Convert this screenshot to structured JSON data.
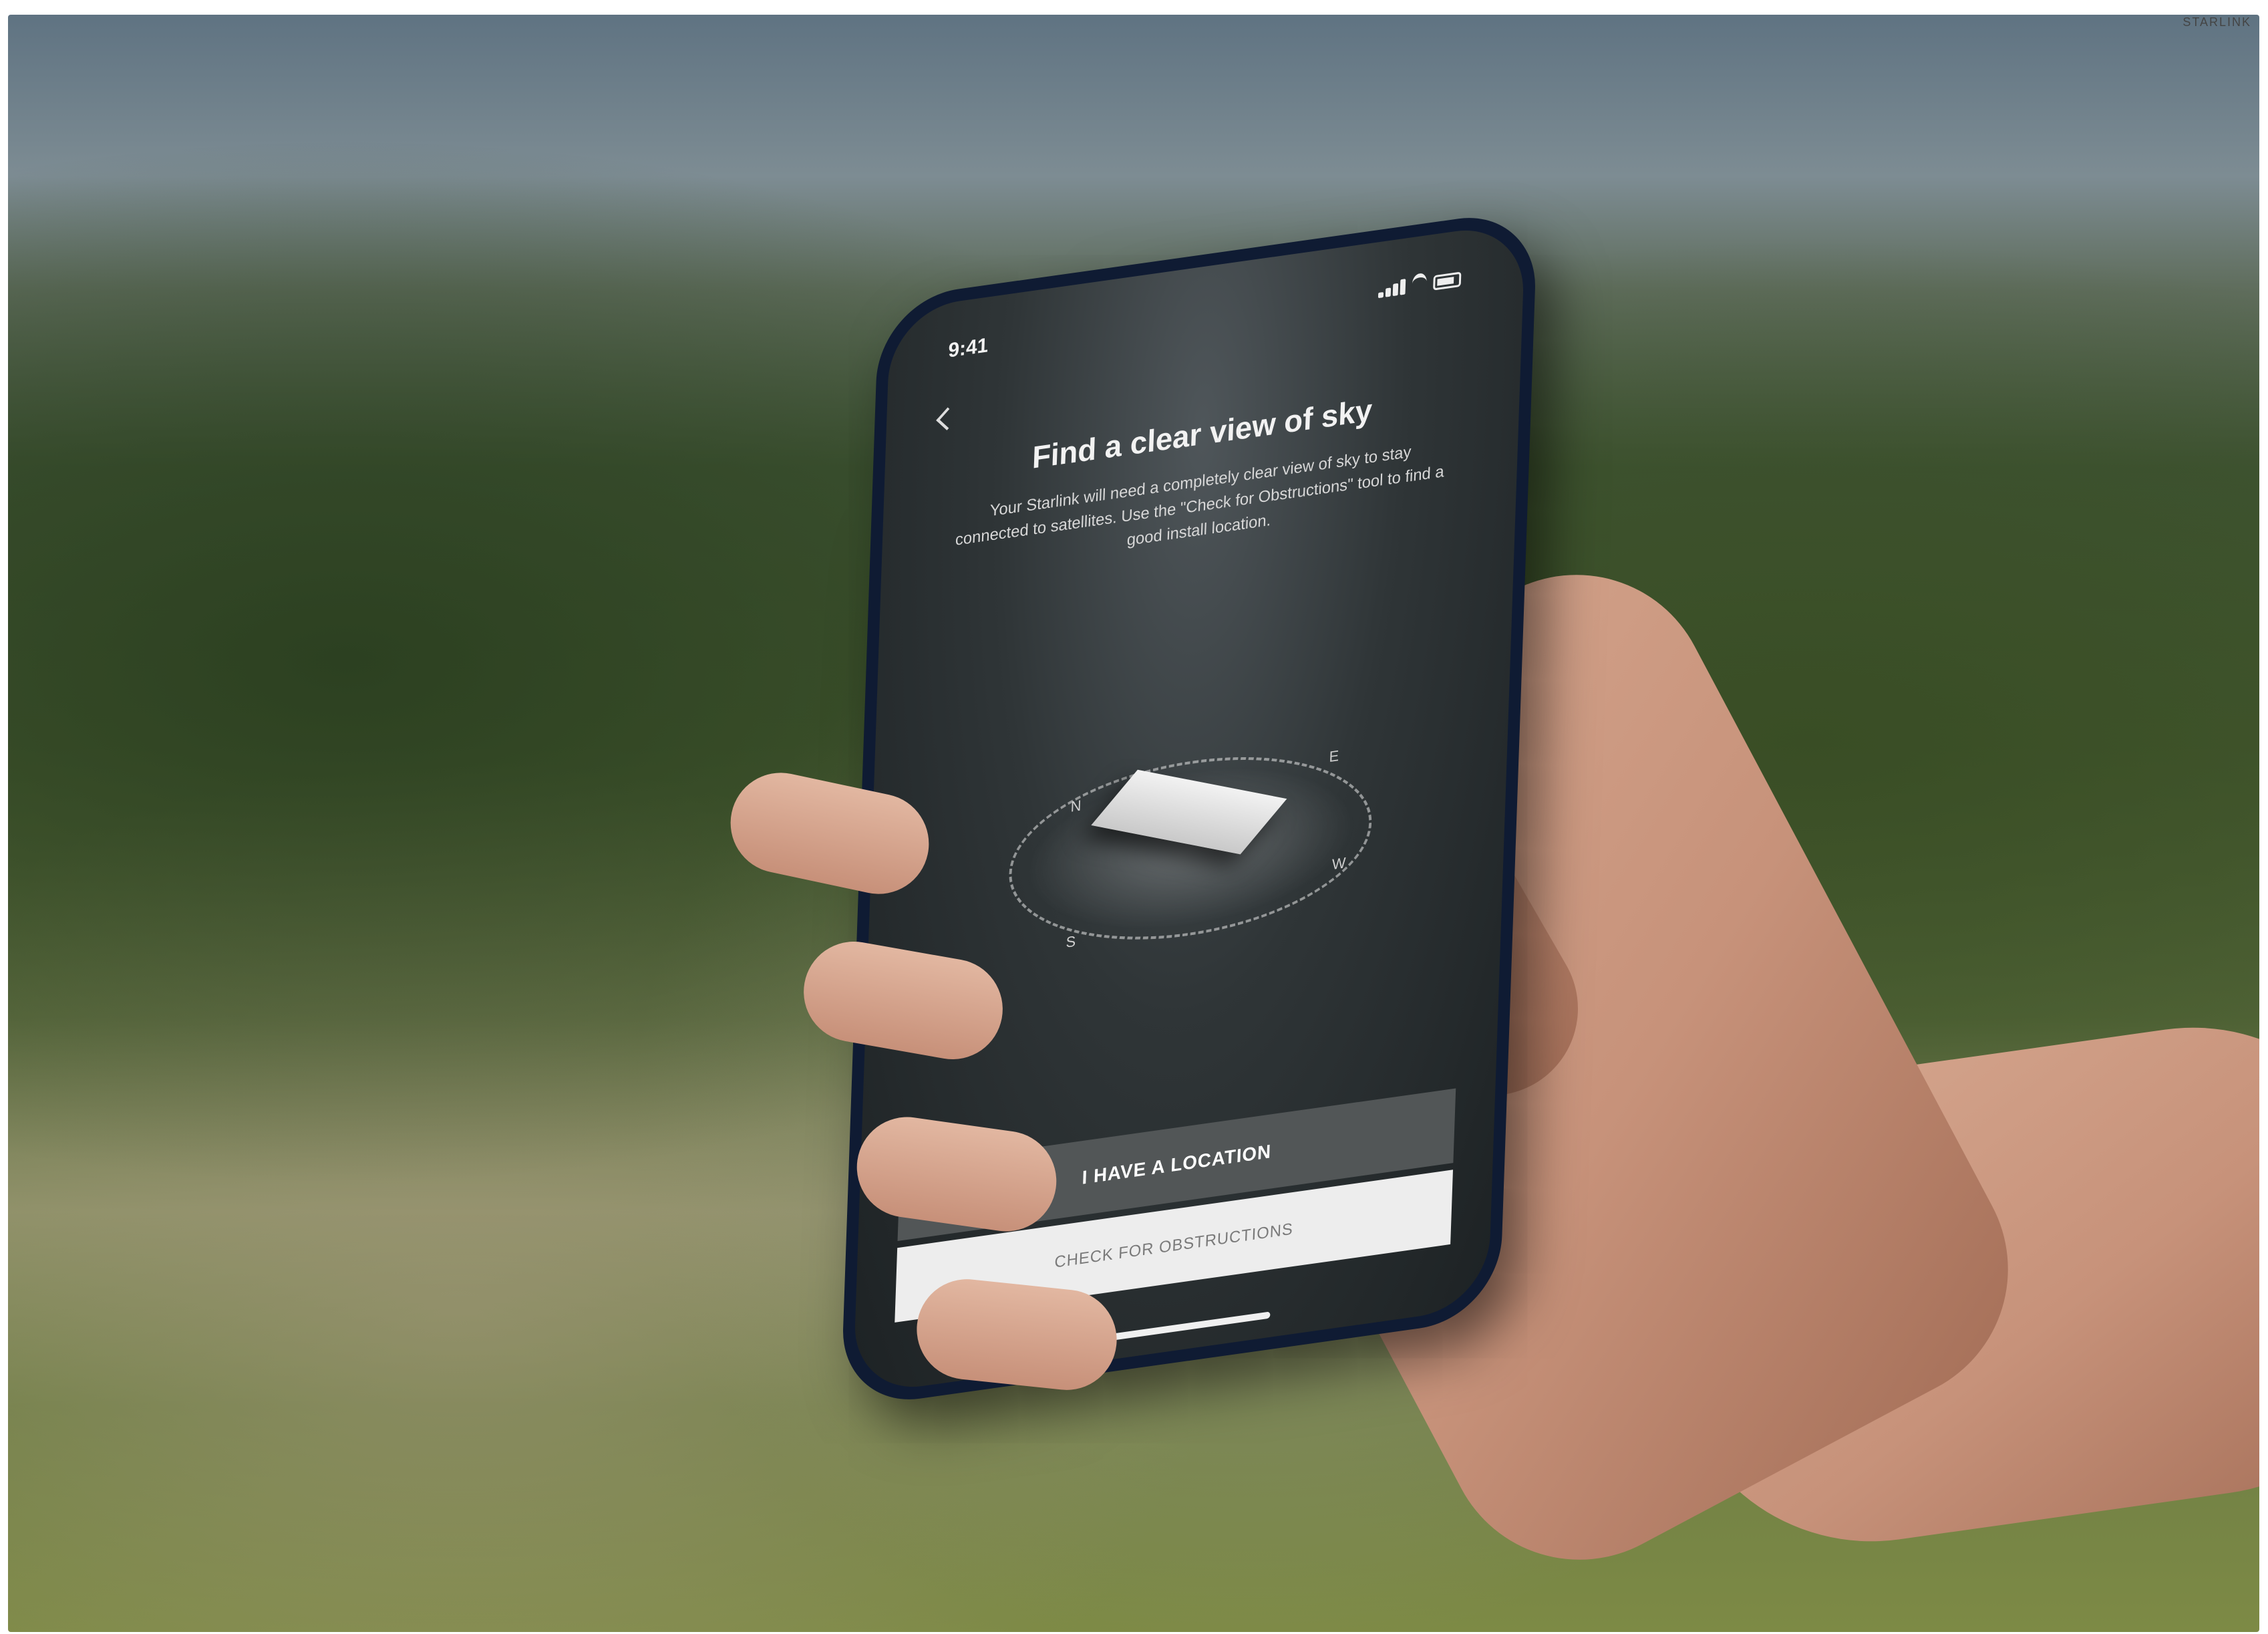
{
  "corner_label": "STARLINK",
  "phone": {
    "status_time": "9:41",
    "title": "Find a clear view of sky",
    "description": "Your Starlink will need a completely clear view of sky to stay connected to satellites. Use the \"Check for Obstructions\" tool to find a good install location.",
    "compass_labels": {
      "north": "N",
      "east": "E",
      "south": "S",
      "west": "W"
    },
    "primary_button": "I HAVE A LOCATION",
    "secondary_button": "CHECK FOR OBSTRUCTIONS"
  },
  "colors": {
    "screen_bg": "#2f3537",
    "phone_frame": "#0f1b33",
    "primary_button": "#525657",
    "secondary_button": "#ededed"
  }
}
